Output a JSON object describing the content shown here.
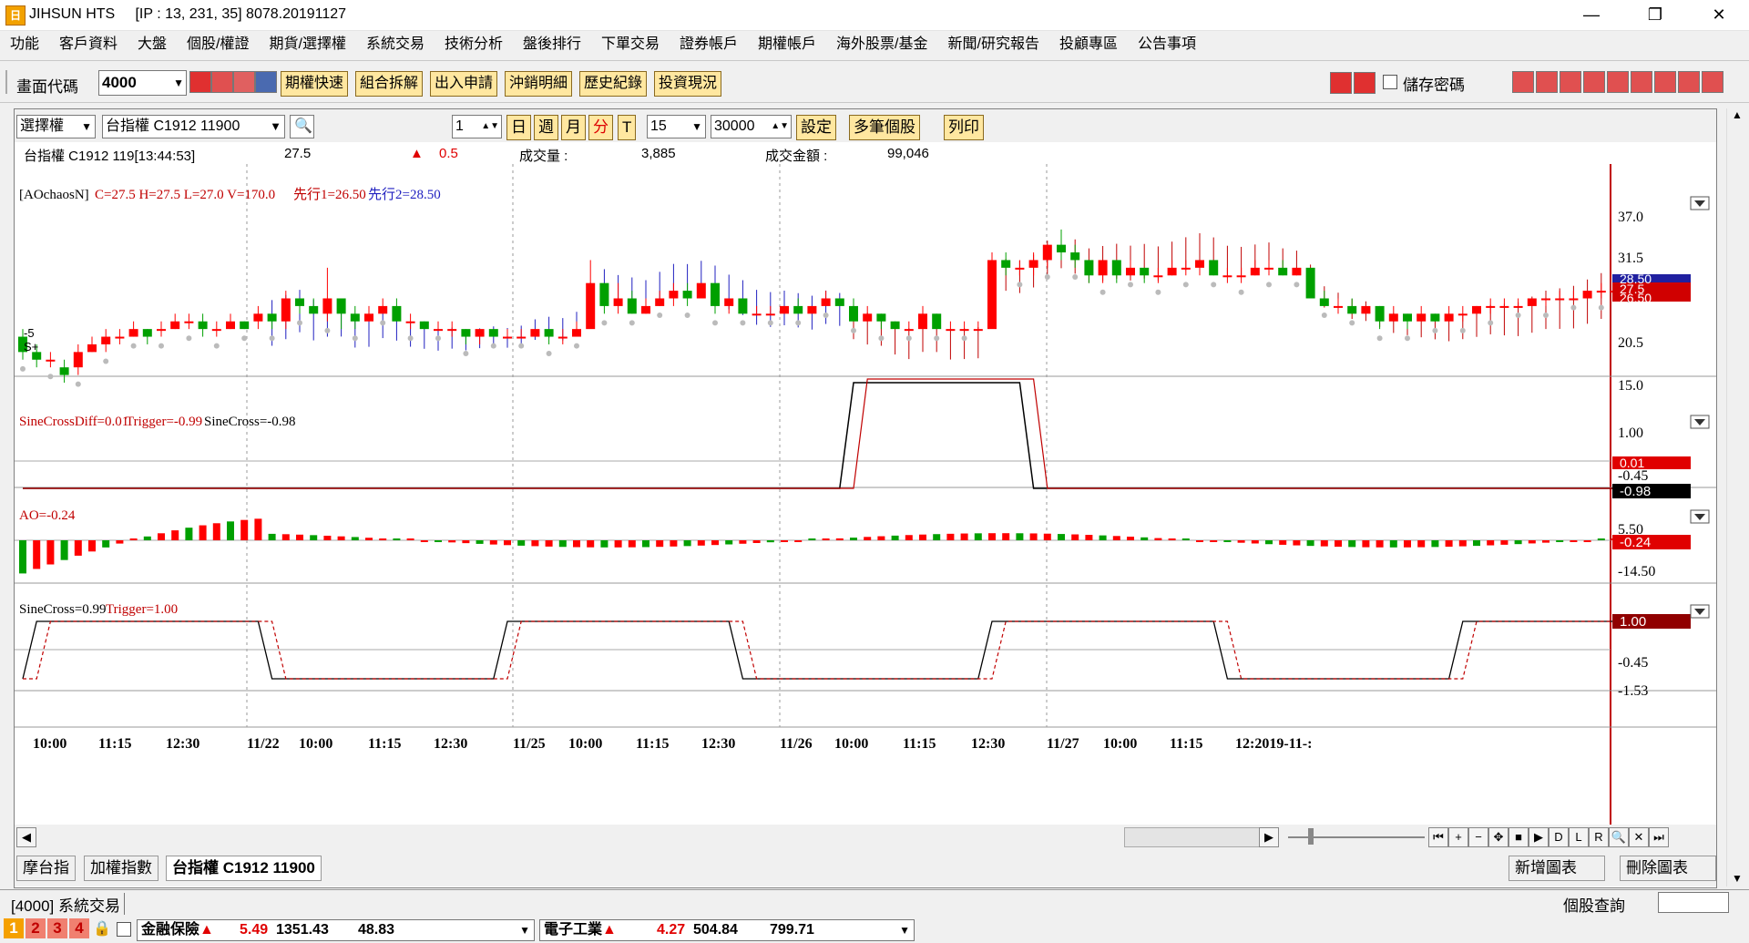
{
  "window": {
    "title": "JIHSUN HTS",
    "connection": "[IP : 13, 231, 35] 8078.20191127",
    "logo_glyph": "日"
  },
  "menu": [
    "功能",
    "客戶資料",
    "大盤",
    "個股/權證",
    "期貨/選擇權",
    "系統交易",
    "技術分析",
    "盤後排行",
    "下單交易",
    "證券帳戶",
    "期權帳戶",
    "海外股票/基金",
    "新聞/研究報告",
    "投顧專區",
    "公告事項"
  ],
  "toolbar": {
    "code_label": "畫面代碼",
    "code_value": "4000",
    "buttons": [
      "期權快速",
      "組合拆解",
      "出入申請",
      "沖銷明細",
      "歷史紀錄",
      "投資現況"
    ],
    "save_password_label": "儲存密碼"
  },
  "chart_toolbar": {
    "type_select": "選擇權",
    "symbol_select": "台指權 C1912 11900",
    "period_value": "1",
    "period_buttons": [
      "日",
      "週",
      "月",
      "分",
      "T"
    ],
    "interval_value": "15",
    "count_value": "30000",
    "actions": [
      "設定",
      "多筆個股",
      "列印"
    ]
  },
  "quote": {
    "name": "台指權 C1912 119[13:44:53]",
    "price": "27.5",
    "change_arrow": "▲",
    "change": "0.5",
    "volume_label": "成交量 :",
    "volume": "3,885",
    "amount_label": "成交金額 :",
    "amount": "99,046"
  },
  "panels": {
    "price": {
      "indicator": "[AOchaosN]",
      "values": "C=27.5 H=27.5 L=27.0 V=170.0",
      "lead1": "先行1=26.50",
      "lead2": "先行2=28.50",
      "marker1": "-5",
      "marker2": "S+",
      "yticks": [
        "37.0",
        "31.5",
        "20.5",
        "15.0"
      ],
      "badge_top": "28.50",
      "badge_mid": "27.5",
      "badge_low": "26.50"
    },
    "sinediff": {
      "legend_a": "SineCrossDiff=0.01",
      "legend_b": "Trigger=-0.99",
      "legend_c": "SineCross=-0.98",
      "yticks": [
        "1.00",
        "-0.45"
      ],
      "badge_a": "0.01",
      "badge_b": "-0.98"
    },
    "ao": {
      "legend": "AO=-0.24",
      "yticks": [
        "5.50",
        "-14.50"
      ],
      "badge": "-0.24"
    },
    "sinecross": {
      "legend_a": "SineCross=0.99",
      "legend_b": "Trigger=1.00",
      "yticks": [
        "-0.45",
        "-1.53"
      ],
      "badge": "1.00"
    }
  },
  "time_axis": [
    "10:00",
    "11:15",
    "12:30",
    "11/22",
    "10:00",
    "11:15",
    "12:30",
    "11/25",
    "10:00",
    "11:15",
    "12:30",
    "11/26",
    "10:00",
    "11:15",
    "12:30",
    "11/27",
    "10:00",
    "11:15",
    "12:2019-11-:"
  ],
  "chart_colors": {
    "up": "#ff0000",
    "down": "#00a000",
    "cloud_blue": "#2020c0",
    "cloud_red": "#c00000"
  },
  "tabs": [
    "摩台指",
    "加權指數",
    "台指權 C1912 11900"
  ],
  "chart_actions": [
    "新增圖表",
    "刪除圖表"
  ],
  "status": {
    "screen": "[4000]",
    "name": "系統交易",
    "right": "個股查詢"
  },
  "ticker": {
    "nums": [
      "1",
      "2",
      "3",
      "4"
    ],
    "item1_name": "金融保險",
    "item1_pct": "5.49",
    "item1_idx": "1351.43",
    "item1_chg": "48.83",
    "item2_name": "電子工業",
    "item2_pct": "4.27",
    "item2_idx": "504.84",
    "item2_chg": "799.71"
  },
  "chart_data": {
    "type": "candlestick",
    "y_range": [
      15.0,
      37.0
    ],
    "candles": [
      [
        21,
        19,
        22,
        18
      ],
      [
        19,
        18,
        20,
        17
      ],
      [
        18,
        18,
        19,
        17
      ],
      [
        17,
        16,
        18,
        15
      ],
      [
        17,
        19,
        20,
        16
      ],
      [
        19,
        20,
        21,
        19
      ],
      [
        20,
        21,
        22,
        19
      ],
      [
        21,
        21,
        22,
        20
      ],
      [
        21,
        22,
        23,
        21
      ],
      [
        22,
        21,
        22,
        20
      ],
      [
        22,
        22,
        23,
        21
      ],
      [
        22,
        23,
        24,
        22
      ],
      [
        23,
        23,
        24,
        22
      ],
      [
        23,
        22,
        24,
        21
      ],
      [
        22,
        22,
        23,
        21
      ],
      [
        22,
        23,
        24,
        22
      ],
      [
        23,
        22,
        23,
        22
      ],
      [
        23,
        24,
        25,
        22
      ],
      [
        24,
        23,
        24,
        22
      ],
      [
        23,
        26,
        27,
        22
      ],
      [
        26,
        25,
        26,
        24
      ],
      [
        25,
        24,
        26,
        24
      ],
      [
        24,
        26,
        30,
        23
      ],
      [
        26,
        24,
        26,
        22
      ],
      [
        24,
        23,
        25,
        22
      ],
      [
        23,
        24,
        25,
        23
      ],
      [
        24,
        25,
        26,
        24
      ],
      [
        25,
        23,
        26,
        23
      ],
      [
        23,
        23,
        24,
        22
      ],
      [
        23,
        22,
        23,
        22
      ],
      [
        22,
        22,
        23,
        22
      ],
      [
        22,
        22,
        23,
        21
      ],
      [
        22,
        21,
        22,
        20
      ],
      [
        21,
        22,
        22,
        20
      ],
      [
        22,
        21,
        22,
        21
      ],
      [
        21,
        21,
        22,
        21
      ],
      [
        21,
        21,
        22,
        21
      ],
      [
        21,
        22,
        22,
        21
      ],
      [
        22,
        21,
        22,
        20
      ],
      [
        21,
        21,
        22,
        20
      ],
      [
        21,
        22,
        23,
        21
      ],
      [
        22,
        28,
        31,
        26
      ],
      [
        28,
        25,
        28,
        24
      ],
      [
        25,
        26,
        28,
        24
      ],
      [
        26,
        24,
        27,
        24
      ],
      [
        24,
        25,
        26,
        24
      ],
      [
        25,
        26,
        27,
        25
      ],
      [
        26,
        27,
        28,
        25
      ],
      [
        27,
        26,
        28,
        25
      ],
      [
        26,
        28,
        28,
        26
      ],
      [
        28,
        25,
        28,
        24
      ],
      [
        25,
        26,
        26,
        24
      ],
      [
        26,
        24,
        26,
        24
      ],
      [
        24,
        24,
        25,
        24
      ],
      [
        24,
        24,
        25,
        24
      ],
      [
        24,
        25,
        25,
        24
      ],
      [
        25,
        24,
        26,
        24
      ],
      [
        24,
        25,
        25,
        24
      ],
      [
        25,
        26,
        27,
        25
      ],
      [
        26,
        25,
        26,
        25
      ],
      [
        25,
        23,
        26,
        23
      ],
      [
        23,
        24,
        25,
        23
      ],
      [
        24,
        23,
        24,
        22
      ],
      [
        23,
        22,
        23,
        22
      ],
      [
        22,
        22,
        23,
        22
      ],
      [
        22,
        24,
        25,
        22
      ],
      [
        24,
        22,
        24,
        22
      ],
      [
        22,
        22,
        23,
        22
      ],
      [
        22,
        22,
        23,
        22
      ],
      [
        22,
        22,
        23,
        22
      ],
      [
        22,
        31,
        32,
        30
      ],
      [
        31,
        30,
        32,
        29
      ],
      [
        30,
        30,
        31,
        29
      ],
      [
        30,
        31,
        32,
        29
      ],
      [
        31,
        33,
        33,
        30
      ],
      [
        33,
        32,
        35,
        31
      ],
      [
        32,
        31,
        33,
        30
      ],
      [
        31,
        29,
        31,
        28
      ],
      [
        29,
        31,
        31,
        28
      ],
      [
        31,
        29,
        31,
        28
      ],
      [
        29,
        30,
        31,
        29
      ],
      [
        30,
        29,
        30,
        28
      ],
      [
        29,
        29,
        30,
        28
      ],
      [
        29,
        30,
        31,
        29
      ],
      [
        30,
        30,
        31,
        29
      ],
      [
        30,
        31,
        31,
        29
      ],
      [
        31,
        29,
        31,
        29
      ],
      [
        29,
        29,
        30,
        28
      ],
      [
        29,
        29,
        30,
        28
      ],
      [
        29,
        30,
        31,
        29
      ],
      [
        30,
        30,
        31,
        29
      ],
      [
        30,
        29,
        31,
        29
      ],
      [
        29,
        30,
        30,
        29
      ],
      [
        30,
        26,
        30,
        26
      ],
      [
        26,
        25,
        27,
        25
      ],
      [
        25,
        25,
        26,
        24
      ],
      [
        25,
        24,
        26,
        24
      ],
      [
        24,
        25,
        25,
        24
      ],
      [
        25,
        23,
        25,
        22
      ],
      [
        23,
        24,
        25,
        23
      ],
      [
        24,
        23,
        24,
        22
      ],
      [
        23,
        24,
        25,
        23
      ],
      [
        24,
        23,
        24,
        23
      ],
      [
        23,
        24,
        25,
        23
      ],
      [
        24,
        24,
        25,
        23
      ],
      [
        24,
        25,
        25,
        24
      ],
      [
        25,
        25,
        26,
        24
      ],
      [
        25,
        25,
        26,
        25
      ],
      [
        25,
        25,
        26,
        25
      ],
      [
        25,
        26,
        26,
        25
      ],
      [
        26,
        26,
        26,
        25
      ],
      [
        26,
        26,
        27,
        26
      ],
      [
        26,
        26,
        27,
        26
      ],
      [
        26,
        27,
        27,
        26
      ],
      [
        27,
        27,
        28,
        26
      ],
      [
        27,
        27,
        28,
        27
      ],
      [
        27,
        27,
        28,
        27
      ]
    ]
  }
}
